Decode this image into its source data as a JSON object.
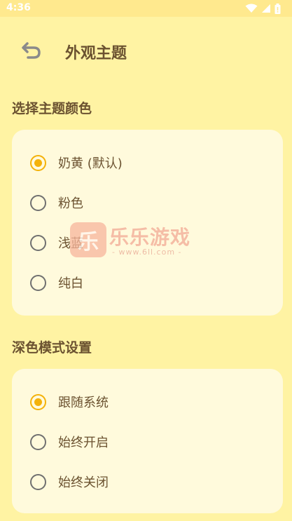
{
  "status_bar": {
    "time": "4:36",
    "icons": [
      "wifi-icon",
      "signal-icon",
      "battery-icon"
    ]
  },
  "header": {
    "back_icon": "back-arrow-icon",
    "title": "外观主题"
  },
  "theme_section": {
    "title": "选择主题颜色",
    "options": [
      {
        "label": "奶黄 (默认)",
        "selected": true
      },
      {
        "label": "粉色",
        "selected": false
      },
      {
        "label": "浅蓝",
        "selected": false
      },
      {
        "label": "纯白",
        "selected": false
      }
    ]
  },
  "dark_section": {
    "title": "深色模式设置",
    "options": [
      {
        "label": "跟随系统",
        "selected": true
      },
      {
        "label": "始终开启",
        "selected": false
      },
      {
        "label": "始终关闭",
        "selected": false
      }
    ]
  },
  "watermark": {
    "logo_char": "乐",
    "name": "乐乐游戏",
    "url": "- www.6ll.com -"
  },
  "colors": {
    "background": "#FFF3A3",
    "card": "#FFFADC",
    "accent": "#F4B20A",
    "text": "#6B5230"
  }
}
